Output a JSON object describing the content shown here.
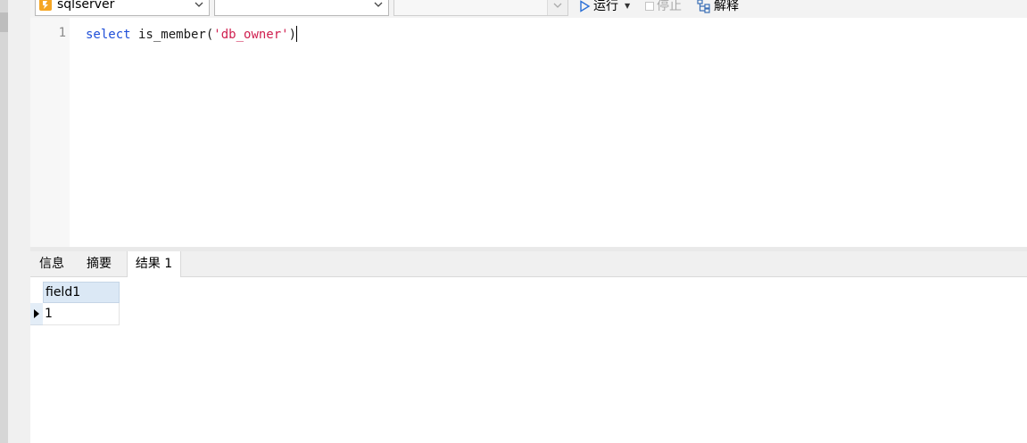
{
  "toolbar": {
    "connection": {
      "value": "sqlserver",
      "icon": "database-icon"
    },
    "database": {
      "value": ""
    },
    "schema": {
      "value": ""
    },
    "run_label": "运行",
    "stop_label": "停止",
    "explain_label": "解释"
  },
  "editor": {
    "lines": [
      {
        "number": "1",
        "keyword": "select",
        "func": " is_member(",
        "string": "'db_owner'",
        "tail": ")"
      }
    ]
  },
  "result_tabs": [
    {
      "label": "信息"
    },
    {
      "label": "摘要"
    },
    {
      "label": "结果 1",
      "active": true
    }
  ],
  "grid": {
    "columns": [
      "field1"
    ],
    "rows": [
      [
        "1"
      ]
    ]
  },
  "colors": {
    "keyword": "#1f4fd8",
    "string": "#d02050",
    "header_bg": "#dbe8f5"
  }
}
